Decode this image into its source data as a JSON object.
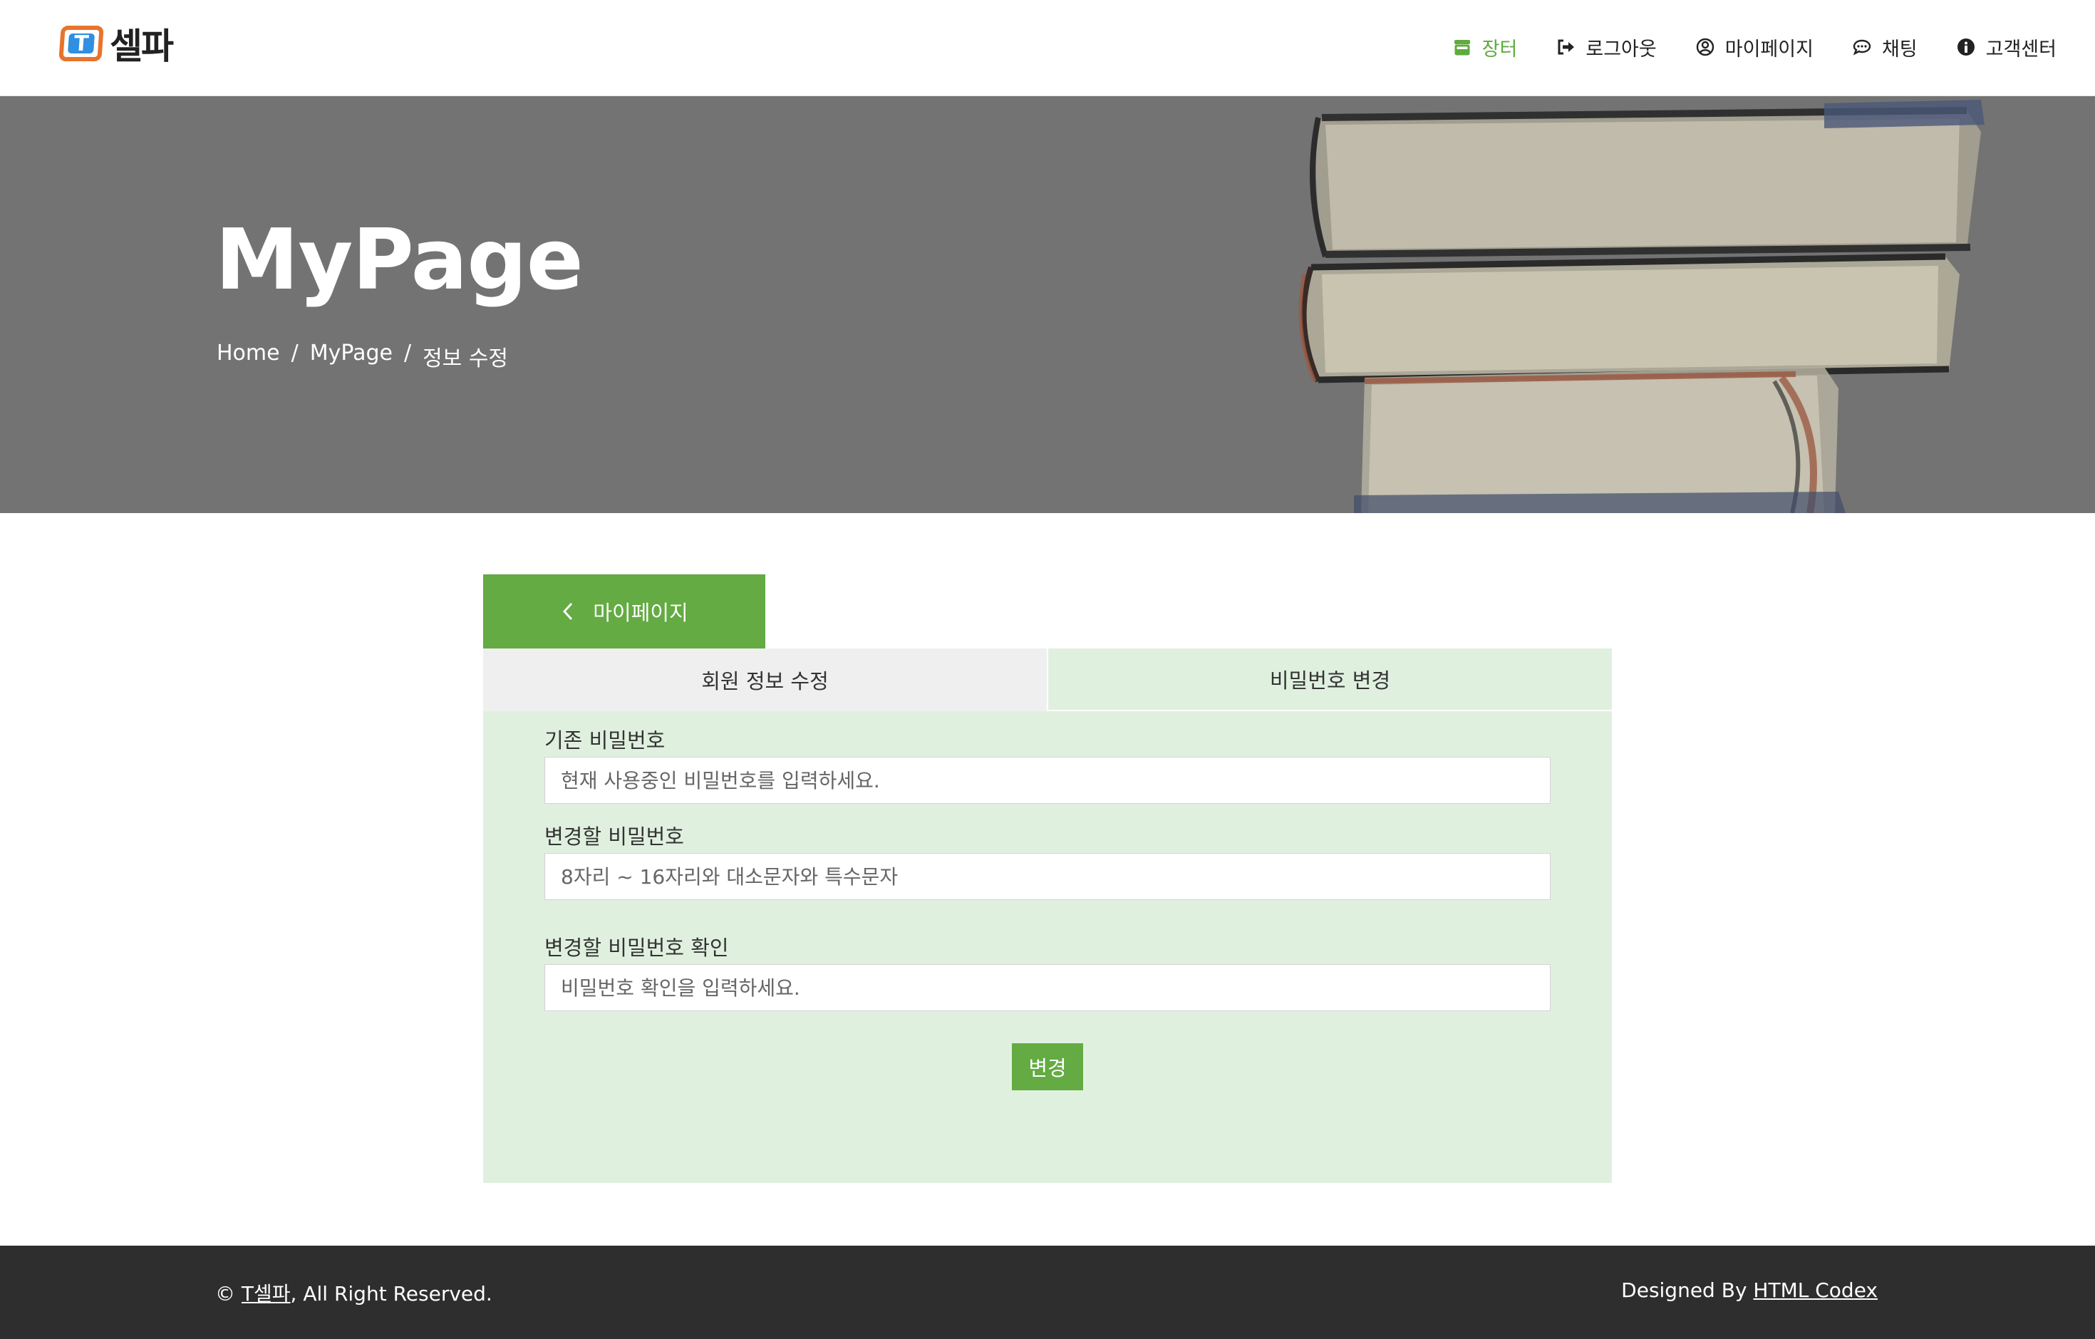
{
  "brand": {
    "logo_letter": "T",
    "name": "셀파",
    "colors": {
      "orange": "#e8742c",
      "blue": "#2f8fe0"
    }
  },
  "nav": {
    "items": [
      {
        "label": "장터",
        "icon": "store-icon",
        "active": true
      },
      {
        "label": "로그아웃",
        "icon": "sign-out-icon",
        "active": false
      },
      {
        "label": "마이페이지",
        "icon": "user-circle-icon",
        "active": false
      },
      {
        "label": "채팅",
        "icon": "chat-bubble-icon",
        "active": false
      },
      {
        "label": "고객센터",
        "icon": "info-circle-icon",
        "active": false
      }
    ],
    "active_color": "#5fab3e"
  },
  "hero": {
    "title": "MyPage",
    "breadcrumb": [
      "Home",
      "MyPage",
      "정보 수정"
    ],
    "separator": "/"
  },
  "content": {
    "back_button": {
      "icon": "chevron-left-icon",
      "label": "마이페이지"
    },
    "tabs": [
      {
        "label": "회원 정보 수정",
        "active": false
      },
      {
        "label": "비밀번호 변경",
        "active": true
      }
    ],
    "form": {
      "current_password": {
        "label": "기존 비밀번호",
        "placeholder": "현재 사용중인 비밀번호를 입력하세요.",
        "value": ""
      },
      "new_password": {
        "label": "변경할 비밀번호",
        "placeholder": "8자리 ~ 16자리와 대소문자와 특수문자",
        "value": ""
      },
      "confirm_password": {
        "label": "변경할 비밀번호 확인",
        "placeholder": "비밀번호 확인을 입력하세요.",
        "value": ""
      },
      "submit_label": "변경"
    },
    "colors": {
      "accent": "#63ab42",
      "panel": "#e0f0df",
      "inactive_tab": "#efefef"
    }
  },
  "footer": {
    "copyright_prefix": "©",
    "copyright_link": "T셀파",
    "copyright_suffix": ", All Right Reserved.",
    "designed_prefix": "Designed By",
    "designed_link": "HTML Codex"
  }
}
